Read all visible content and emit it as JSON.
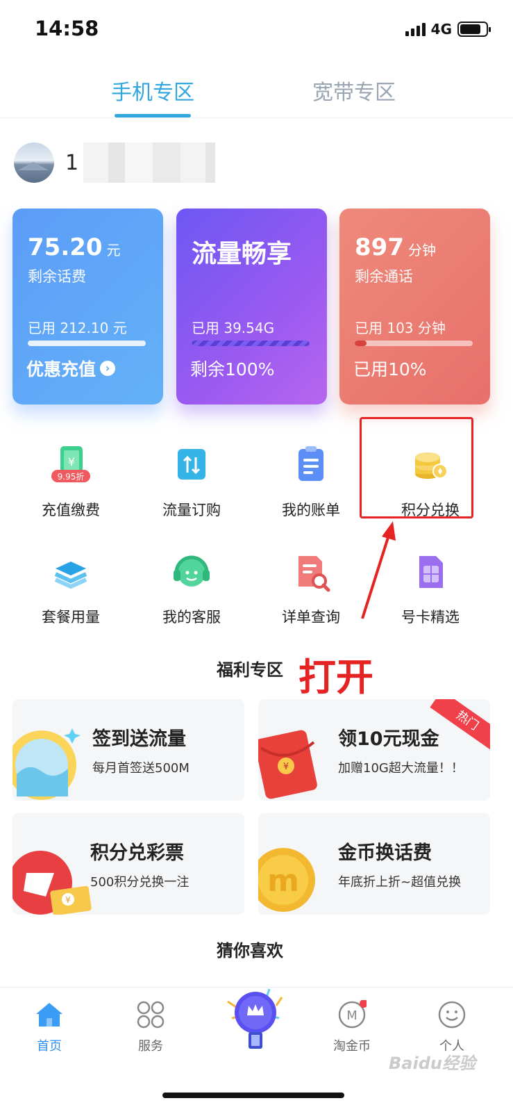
{
  "status_bar": {
    "time": "14:58",
    "network": "4G"
  },
  "tabs": [
    {
      "label": "手机专区",
      "active": true
    },
    {
      "label": "宽带专区",
      "active": false
    }
  ],
  "user": {
    "name_visible": "1"
  },
  "cards": [
    {
      "value": "75.20",
      "unit": "元",
      "sub": "剩余话费",
      "used": "已用 212.10 元",
      "progress_fraction": 1.0,
      "footer": "优惠充值"
    },
    {
      "title": "流量畅享",
      "used": "已用 39.54G",
      "progress_fraction": 1.0,
      "footer": "剩余100%"
    },
    {
      "value": "897",
      "unit": "分钟",
      "sub": "剩余通话",
      "used": "已用 103 分钟",
      "progress_fraction": 0.1,
      "footer": "已用10%"
    }
  ],
  "shortcuts": [
    {
      "label": "充值缴费",
      "icon": "phone-recharge-icon",
      "badge": "9.95折"
    },
    {
      "label": "流量订购",
      "icon": "data-order-icon"
    },
    {
      "label": "我的账单",
      "icon": "bill-icon"
    },
    {
      "label": "积分兑换",
      "icon": "coins-icon"
    },
    {
      "label": "套餐用量",
      "icon": "layers-icon"
    },
    {
      "label": "我的客服",
      "icon": "headset-icon"
    },
    {
      "label": "详单查询",
      "icon": "document-search-icon"
    },
    {
      "label": "号卡精选",
      "icon": "sim-card-icon"
    }
  ],
  "annotation": {
    "text": "打开"
  },
  "welfare": {
    "title": "福利专区",
    "items": [
      {
        "title": "签到送流量",
        "subtitle": "每月首签送500M"
      },
      {
        "title": "领10元现金",
        "subtitle": "加赠10G超大流量！！",
        "badge": "热门"
      },
      {
        "title": "积分兑彩票",
        "subtitle": "500积分兑换一注"
      },
      {
        "title": "金币换话费",
        "subtitle": "年底折上折~超值兑换"
      }
    ]
  },
  "recommend": {
    "title": "猜你喜欢"
  },
  "bottom_nav": [
    {
      "label": "首页",
      "icon": "home-icon",
      "active": true
    },
    {
      "label": "服务",
      "icon": "services-grid-icon"
    },
    {
      "label": "",
      "icon": "center-crown-icon"
    },
    {
      "label": "淘金币",
      "icon": "gold-coin-icon"
    },
    {
      "label": "个人",
      "icon": "profile-smile-icon"
    }
  ],
  "watermark": "Baidu经验",
  "colors": {
    "accent": "#31a6df",
    "highlight_red": "#e52323",
    "active_nav": "#2f8ff0"
  }
}
